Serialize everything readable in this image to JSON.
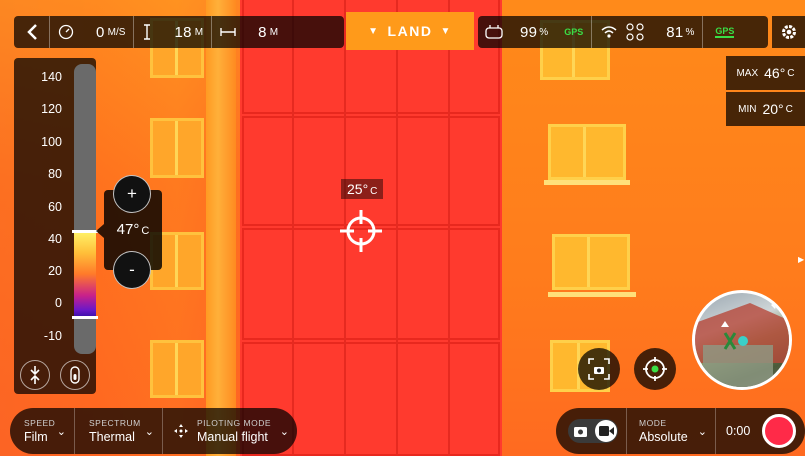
{
  "topbar": {
    "speed": {
      "icon": "gauge-icon",
      "value": "0",
      "unit": "M/S"
    },
    "altitude": {
      "icon": "altitude-icon",
      "value": "18",
      "unit": "M"
    },
    "distance": {
      "icon": "distance-icon",
      "value": "8",
      "unit": "M"
    },
    "land_label": "LAND",
    "controller_battery": {
      "icon": "controller-icon",
      "value": "99",
      "unit": "%",
      "gps_label": "GPS"
    },
    "drone_battery": {
      "icon": "drone-icon",
      "value": "81",
      "unit": "%"
    },
    "drone_gps_label": "GPS",
    "settings_icon": "gear-icon"
  },
  "temp_max": {
    "label": "MAX",
    "value": "46°",
    "unit": "C"
  },
  "temp_min": {
    "label": "MIN",
    "value": "20°",
    "unit": "C"
  },
  "scale": {
    "ticks": [
      "140",
      "120",
      "100",
      "80",
      "60",
      "40",
      "20",
      "0",
      "-10"
    ]
  },
  "focus_temp": {
    "value": "47°",
    "unit": "C",
    "plus": "+",
    "minus": "-"
  },
  "spot_temp": {
    "value": "25°",
    "unit": "C"
  },
  "bottom_left": {
    "speed": {
      "caption": "SPEED",
      "value": "Film"
    },
    "spectrum": {
      "caption": "SPECTRUM",
      "value": "Thermal"
    },
    "piloting": {
      "caption": "PILOTING MODE",
      "value": "Manual flight"
    }
  },
  "bottom_right": {
    "mode": {
      "caption": "MODE",
      "value": "Absolute"
    },
    "timer": "0:00"
  },
  "colors": {
    "accent": "#ff9a1a",
    "gps": "#3adf46",
    "record": "#ff2a48"
  }
}
